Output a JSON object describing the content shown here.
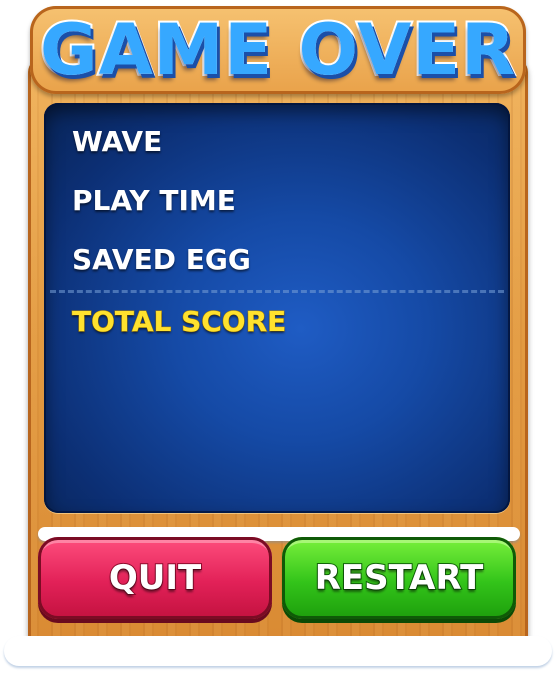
{
  "title": "GAME OVER",
  "stats": {
    "wave_label": "WAVE",
    "play_time_label": "PLAY TIME",
    "saved_egg_label": "SAVED EGG",
    "total_score_label": "TOTAL SCORE"
  },
  "buttons": {
    "quit_label": "QUIT",
    "restart_label": "RESTART"
  },
  "colors": {
    "title": "#36a8ff",
    "panel": "#154aa6",
    "total_score": "#ffe12e",
    "quit_button": "#e22158",
    "restart_button": "#33c41a",
    "wood": "#e39b42"
  }
}
